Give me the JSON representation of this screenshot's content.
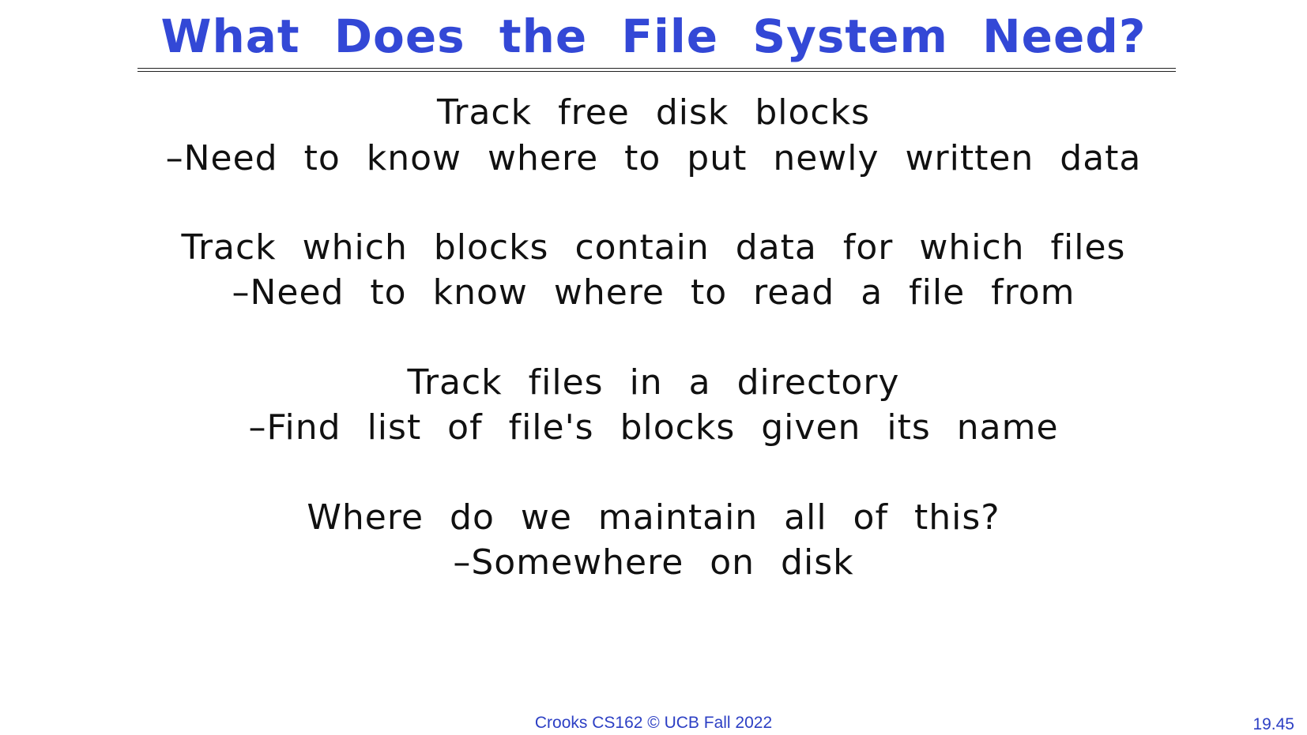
{
  "slide": {
    "title": "What Does the File System Need?",
    "lines": [
      "Track free disk blocks",
      "–Need to know where to put newly written data",
      "Track which blocks contain data for which files",
      "–Need to know where to read a file from",
      "Track files in a directory",
      "–Find list of file's blocks given its name",
      "Where do we maintain all of this?",
      "–Somewhere on disk"
    ]
  },
  "footer": {
    "credit": "Crooks CS162 © UCB Fall 2022",
    "page_number": "19.45"
  },
  "colors": {
    "title": "#3348d6",
    "body_text": "#111111",
    "footer": "#2c3fc4"
  }
}
